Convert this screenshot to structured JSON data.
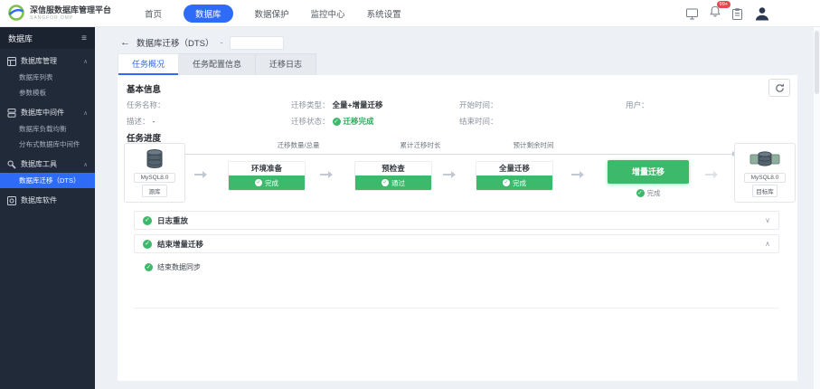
{
  "colors": {
    "accent_blue": "#2e6bf6",
    "success_green": "#3cb96a",
    "sidebar_bg": "#212a38",
    "badge_red": "#e5484d"
  },
  "icons": {
    "check": "✓",
    "chevron_down": "∨",
    "chevron_up": "∧",
    "caret_up": "∧",
    "back_arrow": "←",
    "menu": "≡"
  },
  "topbar": {
    "logo": {
      "title": "深信服数据库管理平台",
      "subtitle": "SANGFOR DMP"
    },
    "nav": [
      {
        "label": "首页"
      },
      {
        "label": "数据库"
      },
      {
        "label": "数据保护"
      },
      {
        "label": "监控中心"
      },
      {
        "label": "系统设置"
      }
    ],
    "notification_badge": "99+"
  },
  "sidebar": {
    "title": "数据库",
    "groups": [
      {
        "label": "数据库管理",
        "items": [
          {
            "label": "数据库列表"
          },
          {
            "label": "参数模板"
          }
        ]
      },
      {
        "label": "数据库中间件",
        "items": [
          {
            "label": "数据库负载均衡"
          },
          {
            "label": "分布式数据库中间件"
          }
        ]
      },
      {
        "label": "数据库工具",
        "items": [
          {
            "label": "数据库迁移（DTS）"
          }
        ]
      },
      {
        "label": "数据库软件",
        "items": []
      }
    ]
  },
  "breadcrumb": {
    "title": "数据库迁移（DTS）",
    "separator": "-"
  },
  "tabs": [
    {
      "label": "任务概况"
    },
    {
      "label": "任务配置信息"
    },
    {
      "label": "迁移日志"
    }
  ],
  "basic_info": {
    "title": "基本信息",
    "task_name": {
      "label": "任务名称：",
      "value": ""
    },
    "migration_type": {
      "label": "迁移类型：",
      "value": "全量+增量迁移"
    },
    "start_time": {
      "label": "开始时间：",
      "value": ""
    },
    "user": {
      "label": "用户：",
      "value": ""
    },
    "description": {
      "label": "描述：",
      "value": "-"
    },
    "migration_status": {
      "label": "迁移状态：",
      "value": "迁移完成"
    },
    "end_time": {
      "label": "结束时间：",
      "value": ""
    }
  },
  "progress": {
    "title": "任务进度",
    "metrics": [
      {
        "label": "迁移数量/总量"
      },
      {
        "label": "累计迁移时长"
      },
      {
        "label": "预计剩余时间"
      }
    ],
    "source": {
      "engine": "MySQL8.0",
      "role": "源库"
    },
    "target": {
      "engine": "MySQL8.0",
      "role": "目标库"
    },
    "stages": [
      {
        "name": "环境准备",
        "status": "完成"
      },
      {
        "name": "预检查",
        "status": "通过"
      },
      {
        "name": "全量迁移",
        "status": "完成"
      },
      {
        "name": "增量迁移",
        "status": "完成"
      }
    ]
  },
  "steps": [
    {
      "label": "日志重放"
    },
    {
      "label": "结束增量迁移",
      "substeps": [
        {
          "label": "结束数据同步"
        }
      ]
    }
  ]
}
